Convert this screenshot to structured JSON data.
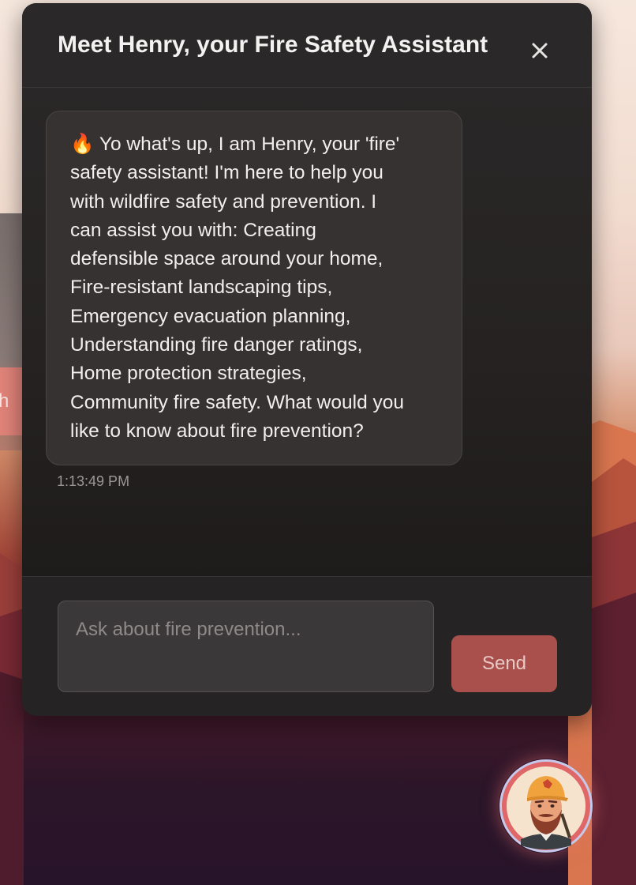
{
  "chat": {
    "title": "Meet Henry, your Fire Safety Assistant",
    "close_icon": "close-icon",
    "messages": [
      {
        "sender": "assistant",
        "emoji": "🔥",
        "lines": [
          "Yo what's up, I am Henry, your 'fire'",
          "safety assistant! I'm here to help you",
          "with wildfire safety and prevention. I",
          "can assist you with: Creating",
          "defensible space around your home,",
          "Fire-resistant landscaping tips,",
          "Emergency evacuation planning,",
          "Understanding fire danger ratings,",
          "Home protection strategies,",
          "Community fire safety. What would you",
          "like to know about fire prevention?"
        ],
        "time": "1:13:49 PM"
      }
    ],
    "input": {
      "value": "",
      "placeholder": "Ask about fire prevention..."
    },
    "send_label": "Send"
  },
  "background": {
    "partial_button_text": "ch"
  },
  "launcher": {
    "icon": "henry-avatar-icon"
  },
  "colors": {
    "panel": "#242222",
    "bubble": "#353231",
    "send_button": "#a9504c",
    "avatar_ring": "#e06767"
  }
}
